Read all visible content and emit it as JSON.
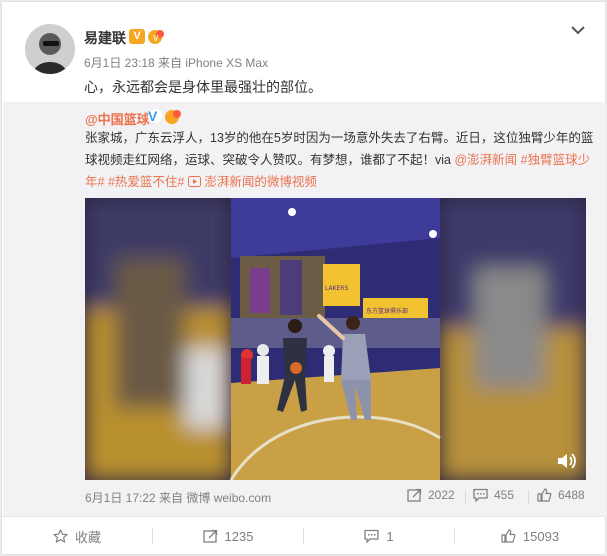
{
  "author": {
    "name": "易建联",
    "verified_badge": "V",
    "meta": "6月1日 23:18 来自 iPhone XS Max",
    "text": "心，永远都会是身体里最强壮的部位。"
  },
  "repost": {
    "user": "@中国篮球",
    "text_plain": "张家城，广东云浮人，13岁的他在5岁时因为一场意外失去了右臂。近日，这位独臂少年的篮球视频走红网络，运球、突破令人赞叹。有梦想，谁都了不起！via ",
    "via_link": "@澎湃新闻",
    "tag1": "#独臂篮球少年#",
    "tag2": "#热爱篮不住#",
    "video_link": "澎湃新闻的微博视频",
    "meta": "6月1日 17:22 来自 微博 weibo.com",
    "forward_count": "2022",
    "comment_count": "455",
    "like_count": "6488",
    "banner1": "LAKERS",
    "banner2": "LAKERS",
    "banner3": "东方篮球俱乐部"
  },
  "actions": {
    "favorite_label": "收藏",
    "forward_count": "1235",
    "comment_count": "1",
    "like_count": "15093"
  },
  "colors": {
    "accent": "#eb7350",
    "text": "#333333",
    "muted": "#808080",
    "repost_bg": "#f2f2f5",
    "verified": "#f6a623",
    "blue_verified": "#38a0ea"
  },
  "icons": [
    "dropdown-caret-icon",
    "forward-icon",
    "comment-icon",
    "like-icon",
    "favorite-icon",
    "volume-icon"
  ]
}
